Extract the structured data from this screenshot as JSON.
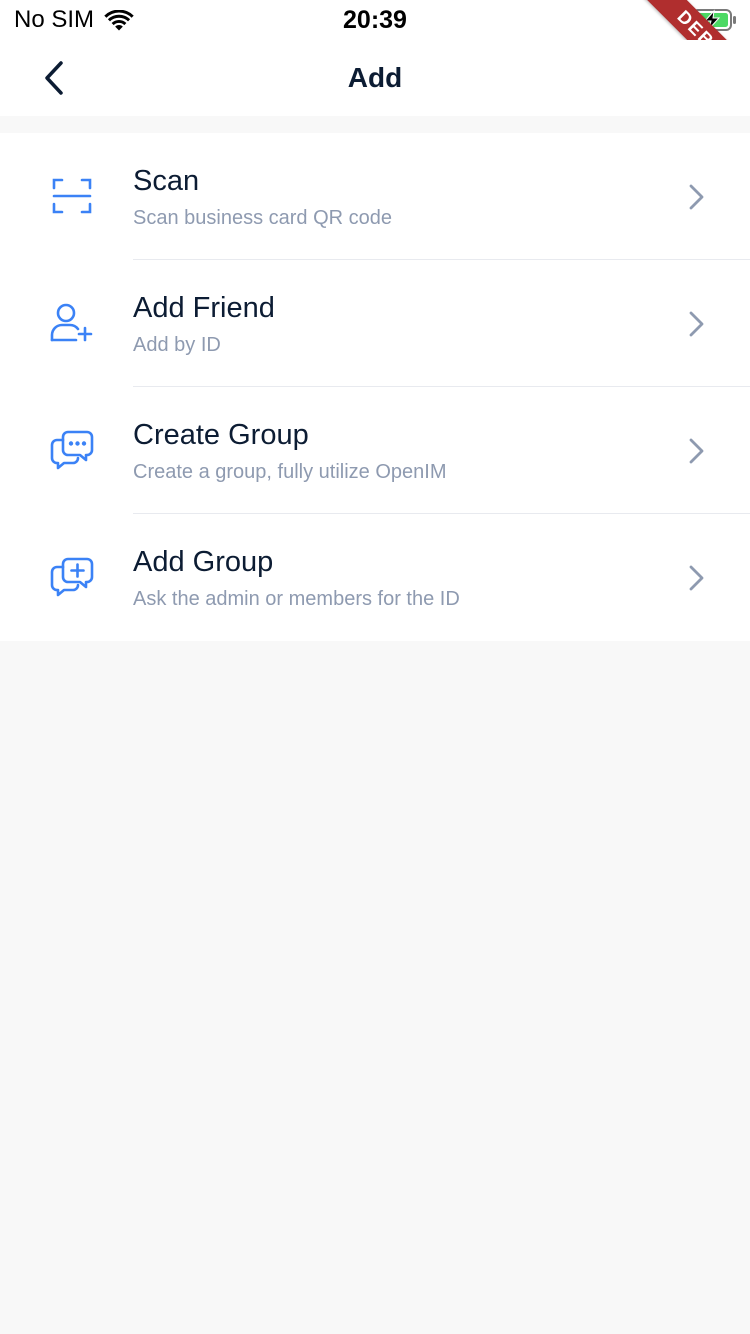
{
  "status_bar": {
    "carrier": "No SIM",
    "time": "20:39",
    "debug_banner": "DEBUG",
    "icons": [
      "wifi-icon",
      "battery-charging-icon"
    ]
  },
  "app_bar": {
    "title": "Add",
    "back_icon": "chevron-left-icon"
  },
  "colors": {
    "accent": "#3b82f6",
    "title_text": "#0c1c33",
    "subtitle_text": "#8e9ab0",
    "page_background": "#f8f8f8",
    "debug_ribbon": "#b02e2e"
  },
  "menu": {
    "items": [
      {
        "label": "Scan",
        "sublabel": "Scan business card QR code",
        "icon": "scan-icon"
      },
      {
        "label": "Add Friend",
        "sublabel": "Add by ID",
        "icon": "add-user-icon"
      },
      {
        "label": "Create Group",
        "sublabel": "Create a group, fully utilize OpenIM",
        "icon": "group-chat-icon"
      },
      {
        "label": "Add Group",
        "sublabel": "Ask the admin or members for the ID",
        "icon": "chat-add-icon"
      }
    ]
  }
}
